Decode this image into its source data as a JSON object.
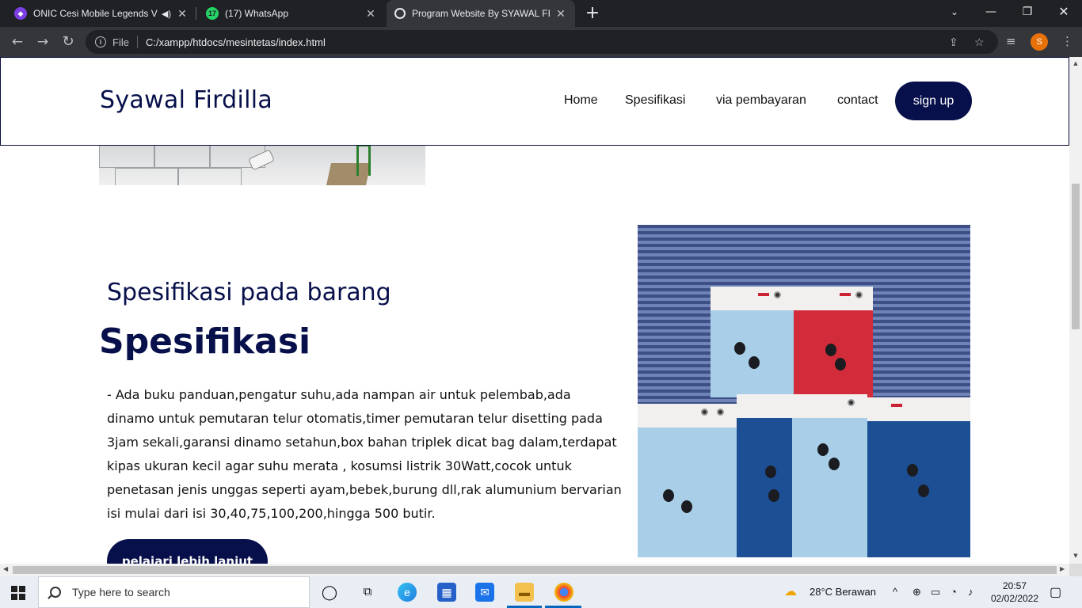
{
  "browser": {
    "tabs": [
      {
        "title": "ONIC Cesi Mobile Legends V",
        "favicon": "onic-icon",
        "audio": true
      },
      {
        "title": "(17) WhatsApp",
        "favicon": "whatsapp-icon",
        "badge": "17"
      },
      {
        "title": "Program Website By SYAWAL FIR",
        "favicon": "globe-icon",
        "active": true
      }
    ],
    "address": {
      "scheme_label": "File",
      "url": "C:/xampp/htdocs/mesintetas/index.html"
    },
    "profile_initial": "S"
  },
  "page": {
    "brand": "Syawal Firdilla",
    "nav": [
      "Home",
      "Spesifikasi",
      "via pembayaran",
      "contact"
    ],
    "signup_label": "sign up",
    "section_subtitle": "Spesifikasi pada barang",
    "section_title": "Spesifikasi",
    "description": "- Ada buku panduan,pengatur suhu,ada nampan air untuk pelembab,ada dinamo untuk pemutaran telur otomatis,timer pemutaran telur disetting pada 3jam sekali,garansi dinamo setahun,box bahan triplek dicat bag dalam,terdapat kipas ukuran kecil agar suhu merata , kosumsi listrik 30Watt,cocok untuk penetasan jenis unggas seperti ayam,bebek,burung dll,rak alumunium bervarian isi mulai dari isi 30,40,75,100,200,hingga 500 butir.",
    "more_button": "pelajari lebih lanjut",
    "colors": {
      "brand": "#07104a"
    }
  },
  "taskbar": {
    "search_placeholder": "Type here to search",
    "weather": "28°C  Berawan",
    "time": "20:57",
    "date": "02/02/2022"
  }
}
